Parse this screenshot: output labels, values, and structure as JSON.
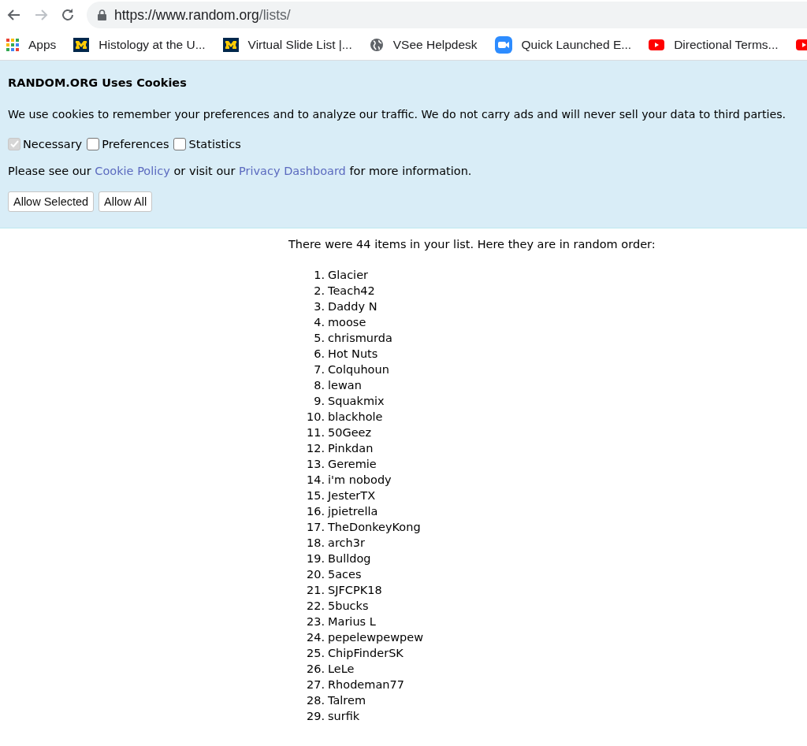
{
  "browser": {
    "url_host": "https://www.random.org",
    "url_path": "/lists/",
    "bookmarks": [
      {
        "kind": "apps",
        "label": "Apps"
      },
      {
        "kind": "block-m",
        "label": "Histology at the U..."
      },
      {
        "kind": "block-m",
        "label": "Virtual Slide List |..."
      },
      {
        "kind": "globe",
        "label": "VSee Helpdesk"
      },
      {
        "kind": "video",
        "label": "Quick Launched E..."
      },
      {
        "kind": "play",
        "label": "Directional Terms..."
      },
      {
        "kind": "play"
      }
    ]
  },
  "cookie_banner": {
    "title": "RANDOM.ORG Uses Cookies",
    "text": "We use cookies to remember your preferences and to analyze our traffic. We do not carry ads and will never sell your data to third parties.",
    "options": [
      {
        "label": "Necessary",
        "checked": true,
        "disabled": true
      },
      {
        "label": "Preferences",
        "checked": false,
        "disabled": false
      },
      {
        "label": "Statistics",
        "checked": false,
        "disabled": false
      }
    ],
    "info_before": "Please see our",
    "link_1": "Cookie Policy",
    "info_middle": "or visit our",
    "link_2": "Privacy Dashboard",
    "info_after": "for more information.",
    "buttons": [
      "Allow Selected",
      "Allow All"
    ]
  },
  "result": {
    "intro": "There were 44 items in your list. Here they are in random order:",
    "items": [
      {
        "number": "1.",
        "name": "Glacier"
      },
      {
        "number": "2.",
        "name": "Teach42"
      },
      {
        "number": "3.",
        "name": "Daddy N"
      },
      {
        "number": "4.",
        "name": "moose"
      },
      {
        "number": "5.",
        "name": "chrismurda"
      },
      {
        "number": "6.",
        "name": "Hot Nuts"
      },
      {
        "number": "7.",
        "name": "Colquhoun"
      },
      {
        "number": "8.",
        "name": "lewan"
      },
      {
        "number": "9.",
        "name": "Squakmix"
      },
      {
        "number": "10.",
        "name": "blackhole"
      },
      {
        "number": "11.",
        "name": "50Geez"
      },
      {
        "number": "12.",
        "name": "Pinkdan"
      },
      {
        "number": "13.",
        "name": "Geremie"
      },
      {
        "number": "14.",
        "name": "i'm nobody"
      },
      {
        "number": "15.",
        "name": "JesterTX"
      },
      {
        "number": "16.",
        "name": "jpietrella"
      },
      {
        "number": "17.",
        "name": "TheDonkeyKong"
      },
      {
        "number": "18.",
        "name": "arch3r"
      },
      {
        "number": "19.",
        "name": "Bulldog"
      },
      {
        "number": "20.",
        "name": "5aces"
      },
      {
        "number": "21.",
        "name": "SJFCPK18"
      },
      {
        "number": "22.",
        "name": "5bucks"
      },
      {
        "number": "23.",
        "name": "Marius L"
      },
      {
        "number": "24.",
        "name": "pepelewpewpew"
      },
      {
        "number": "25.",
        "name": "ChipFinderSK"
      },
      {
        "number": "26.",
        "name": "LeLe"
      },
      {
        "number": "27.",
        "name": "Rhodeman77"
      },
      {
        "number": "28.",
        "name": "Talrem"
      },
      {
        "number": "29.",
        "name": "surfik"
      }
    ]
  }
}
